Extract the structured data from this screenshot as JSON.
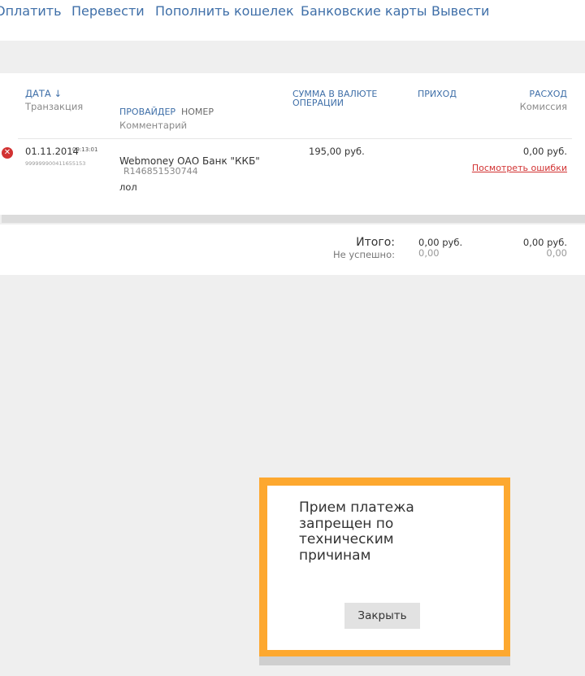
{
  "nav": {
    "items": [
      "Оплатить",
      "Перевести",
      "Пополнить кошелек",
      "Банковские карты",
      "Вывести"
    ]
  },
  "table": {
    "headers": {
      "date": "ДАТА ↓",
      "date_sub": "Транзакция",
      "provider": "ПРОВАЙДЕР",
      "provider_number": "НОМЕР",
      "comment": "Комментарий",
      "amount_line1": "СУММА В ВАЛЮТЕ",
      "amount_line2": "ОПЕРАЦИИ",
      "income": "ПРИХОД",
      "expense": "РАСХОД",
      "commission": "Комиссия"
    },
    "rows": [
      {
        "status": "error",
        "date": "01.11.2014",
        "time": "09:13:01",
        "transaction": "999999900411655153",
        "provider": "Webmoney ОАО Банк \"ККБ\"",
        "number": "R146851530744",
        "comment": "лол",
        "amount": "195,00 руб.",
        "expense": "0,00 руб.",
        "error_link": "Посмотреть ошибки"
      }
    ]
  },
  "totals": {
    "label": "Итого:",
    "failed_label": "Не успешно:",
    "income": "0,00 руб.",
    "income_failed": "0,00",
    "expense": "0,00 руб.",
    "expense_failed": "0,00"
  },
  "dialog": {
    "message": "Прием платежа запрещен по техническим причинам",
    "close_label": "Закрыть"
  },
  "colors": {
    "link": "#3f6fa8",
    "error": "#d23232",
    "dialog_frame": "#fda82f"
  }
}
